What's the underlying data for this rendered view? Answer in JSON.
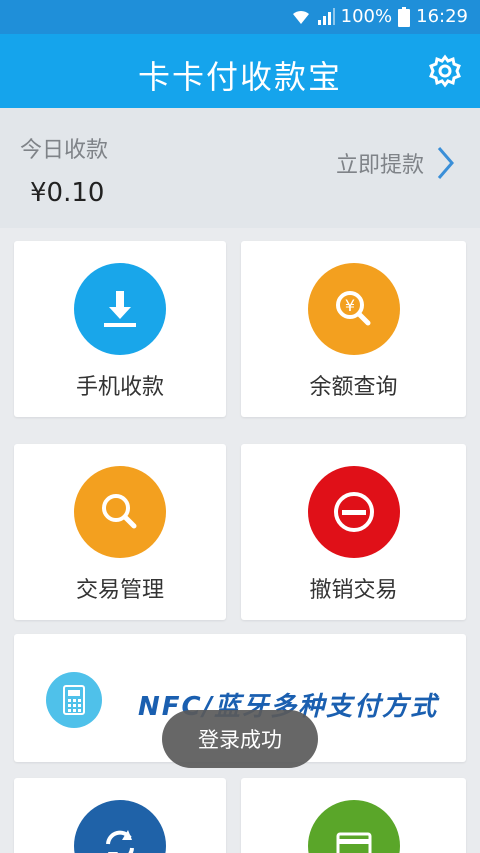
{
  "status_bar": {
    "battery": "100%",
    "time": "16:29"
  },
  "header": {
    "title": "卡卡付收款宝",
    "settings_icon": "gear-icon"
  },
  "summary": {
    "label": "今日收款",
    "amount": "¥0.10",
    "withdraw_label": "立即提款"
  },
  "tiles": [
    {
      "label": "手机收款",
      "icon": "download-icon",
      "color": "#19a6ea"
    },
    {
      "label": "余额查询",
      "icon": "yuan-search-icon",
      "color": "#f3a01f"
    },
    {
      "label": "交易管理",
      "icon": "search-icon",
      "color": "#f3a01f"
    },
    {
      "label": "撤销交易",
      "icon": "minus-circle-icon",
      "color": "#e01018"
    },
    {
      "label": "",
      "icon": "refresh-icon",
      "color": "#1f62a8"
    },
    {
      "label": "",
      "icon": "card-icon",
      "color": "#5aa629"
    }
  ],
  "banner": {
    "text": "NFC/蓝牙多种支付方式",
    "icon": "calculator-icon"
  },
  "toast": {
    "text": "登录成功"
  },
  "colors": {
    "status_bar": "#1f8fd9",
    "app_bar": "#15a4ec",
    "background": "#e9ebee",
    "summary_bg": "#e2e6ea"
  }
}
